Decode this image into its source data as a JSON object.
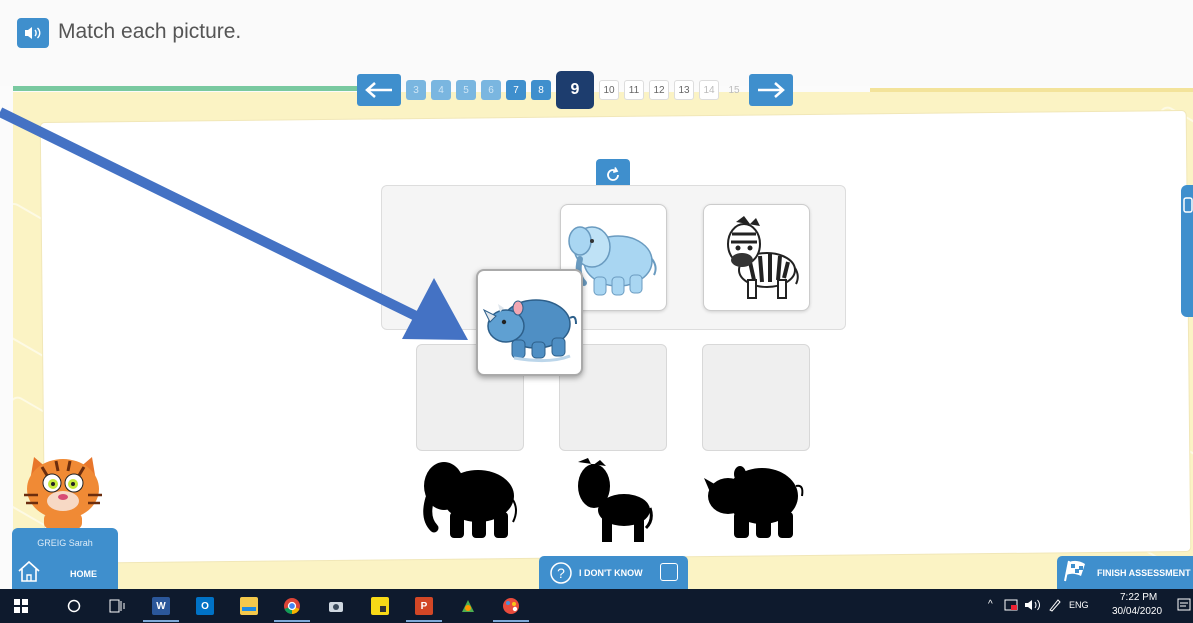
{
  "instruction": "Match each picture.",
  "pager": {
    "pages": [
      "3",
      "4",
      "5",
      "6",
      "7",
      "8",
      "9",
      "10",
      "11",
      "12",
      "13",
      "14",
      "15"
    ],
    "current": "9"
  },
  "user": {
    "name": "GREIG Sarah",
    "home_label": "HOME"
  },
  "buttons": {
    "dont_know": "I DON'T KNOW",
    "finish": "FINISH ASSESSMENT"
  },
  "cards": [
    "rhino",
    "elephant",
    "zebra"
  ],
  "silhouettes": [
    "elephant",
    "zebra",
    "rhino"
  ],
  "taskbar": {
    "time": "7:22 PM",
    "date": "30/04/2020",
    "lang": "ENG"
  },
  "colors": {
    "accent": "#3f8fcd",
    "current_page": "#1d3d6e",
    "stage": "#fbf3c4",
    "taskbar": "#0e1a2d",
    "arrow": "#4472c4"
  }
}
